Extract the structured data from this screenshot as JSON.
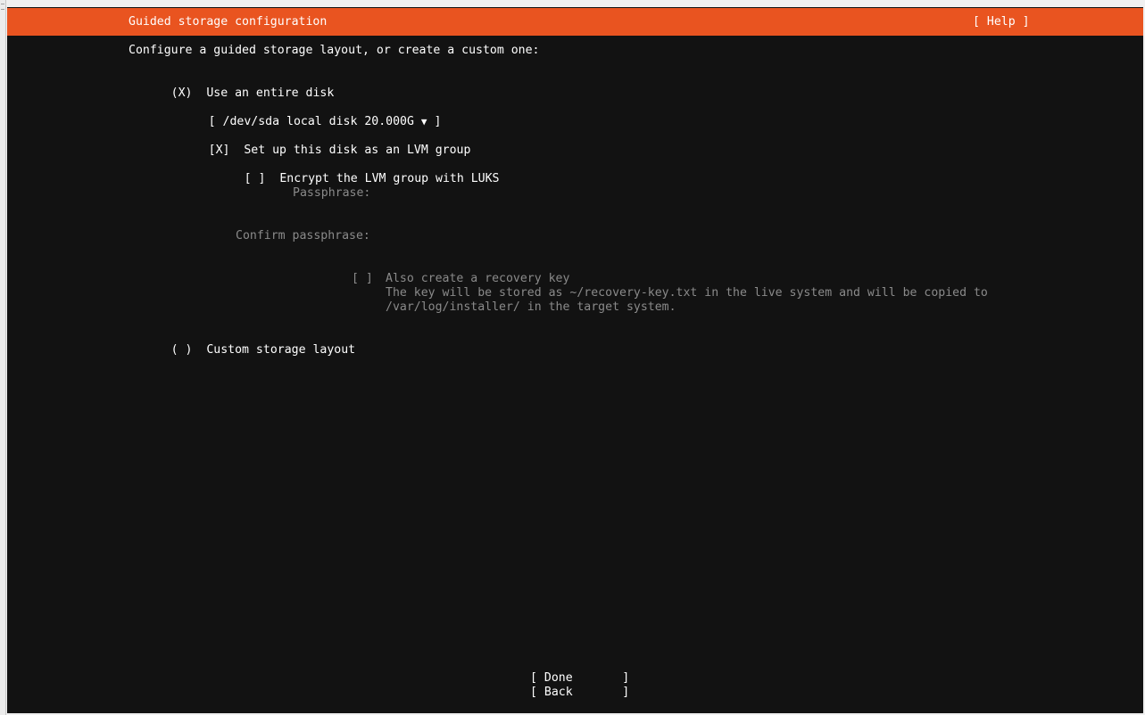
{
  "header": {
    "title": "Guided storage configuration",
    "help_label": "[ Help ]"
  },
  "intro": "Configure a guided storage layout, or create a custom one:",
  "entire_disk": {
    "radio": "(X)",
    "label": "Use an entire disk"
  },
  "disk_select": {
    "open": "[",
    "value": "/dev/sda local disk 20.000G",
    "arrow": "▼",
    "close": "]"
  },
  "lvm": {
    "checkbox": "[X]",
    "label": "Set up this disk as an LVM group"
  },
  "luks": {
    "checkbox": "[ ]",
    "label": "Encrypt the LVM group with LUKS"
  },
  "passphrase": {
    "label": "Passphrase:"
  },
  "confirm_passphrase": {
    "label": "Confirm passphrase:"
  },
  "recovery": {
    "checkbox": "[ ]",
    "label": "Also create a recovery key",
    "desc_line1": "The key will be stored as ~/recovery-key.txt in the live system and will be copied to",
    "desc_line2": "/var/log/installer/ in the target system."
  },
  "custom_layout": {
    "radio": "( )",
    "label": "Custom storage layout"
  },
  "buttons": {
    "done": "[ Done       ]",
    "back": "[ Back       ]"
  },
  "colors": {
    "accent": "#e95420",
    "background": "#121212",
    "text": "#ffffff",
    "disabled_text": "#8a8a8a"
  }
}
